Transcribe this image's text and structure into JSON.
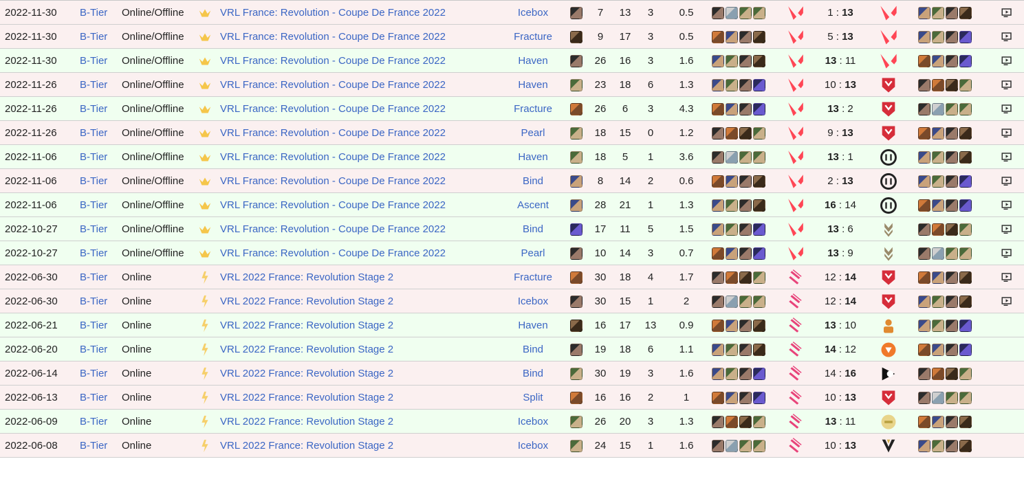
{
  "colors": {
    "win_row": "#f0fff0",
    "loss_row": "#fbf0f0",
    "link": "#3b66c4",
    "team_red": "#ff4655",
    "opp_pink": "#e8437a"
  },
  "rows": [
    {
      "date": "2022-11-30",
      "tier": "B-Tier",
      "type": "Online/Offline",
      "event": "VRL France: Revolution - Coupe De France 2022",
      "map": "Icebox",
      "k": "7",
      "d": "13",
      "a": "3",
      "kd": "0.5",
      "score_team": "1",
      "score_opp": "13",
      "result": "loss",
      "has_vod": true
    },
    {
      "date": "2022-11-30",
      "tier": "B-Tier",
      "type": "Online/Offline",
      "event": "VRL France: Revolution - Coupe De France 2022",
      "map": "Fracture",
      "k": "9",
      "d": "17",
      "a": "3",
      "kd": "0.5",
      "score_team": "5",
      "score_opp": "13",
      "result": "loss",
      "has_vod": true
    },
    {
      "date": "2022-11-30",
      "tier": "B-Tier",
      "type": "Online/Offline",
      "event": "VRL France: Revolution - Coupe De France 2022",
      "map": "Haven",
      "k": "26",
      "d": "16",
      "a": "3",
      "kd": "1.6",
      "score_team": "13",
      "score_opp": "11",
      "result": "win",
      "has_vod": true
    },
    {
      "date": "2022-11-26",
      "tier": "B-Tier",
      "type": "Online/Offline",
      "event": "VRL France: Revolution - Coupe De France 2022",
      "map": "Haven",
      "k": "23",
      "d": "18",
      "a": "6",
      "kd": "1.3",
      "score_team": "10",
      "score_opp": "13",
      "result": "loss",
      "has_vod": true
    },
    {
      "date": "2022-11-26",
      "tier": "B-Tier",
      "type": "Online/Offline",
      "event": "VRL France: Revolution - Coupe De France 2022",
      "map": "Fracture",
      "k": "26",
      "d": "6",
      "a": "3",
      "kd": "4.3",
      "score_team": "13",
      "score_opp": "2",
      "result": "win",
      "has_vod": true
    },
    {
      "date": "2022-11-26",
      "tier": "B-Tier",
      "type": "Online/Offline",
      "event": "VRL France: Revolution - Coupe De France 2022",
      "map": "Pearl",
      "k": "18",
      "d": "15",
      "a": "0",
      "kd": "1.2",
      "score_team": "9",
      "score_opp": "13",
      "result": "loss",
      "has_vod": true
    },
    {
      "date": "2022-11-06",
      "tier": "B-Tier",
      "type": "Online/Offline",
      "event": "VRL France: Revolution - Coupe De France 2022",
      "map": "Haven",
      "k": "18",
      "d": "5",
      "a": "1",
      "kd": "3.6",
      "score_team": "13",
      "score_opp": "1",
      "result": "win",
      "has_vod": true
    },
    {
      "date": "2022-11-06",
      "tier": "B-Tier",
      "type": "Online/Offline",
      "event": "VRL France: Revolution - Coupe De France 2022",
      "map": "Bind",
      "k": "8",
      "d": "14",
      "a": "2",
      "kd": "0.6",
      "score_team": "2",
      "score_opp": "13",
      "result": "loss",
      "has_vod": true
    },
    {
      "date": "2022-11-06",
      "tier": "B-Tier",
      "type": "Online/Offline",
      "event": "VRL France: Revolution - Coupe De France 2022",
      "map": "Ascent",
      "k": "28",
      "d": "21",
      "a": "1",
      "kd": "1.3",
      "score_team": "16",
      "score_opp": "14",
      "result": "win",
      "has_vod": true
    },
    {
      "date": "2022-10-27",
      "tier": "B-Tier",
      "type": "Online/Offline",
      "event": "VRL France: Revolution - Coupe De France 2022",
      "map": "Bind",
      "k": "17",
      "d": "11",
      "a": "5",
      "kd": "1.5",
      "score_team": "13",
      "score_opp": "6",
      "result": "win",
      "has_vod": true
    },
    {
      "date": "2022-10-27",
      "tier": "B-Tier",
      "type": "Online/Offline",
      "event": "VRL France: Revolution - Coupe De France 2022",
      "map": "Pearl",
      "k": "10",
      "d": "14",
      "a": "3",
      "kd": "0.7",
      "score_team": "13",
      "score_opp": "9",
      "result": "win",
      "has_vod": true
    },
    {
      "date": "2022-06-30",
      "tier": "B-Tier",
      "type": "Online",
      "event": "VRL 2022 France: Revolution Stage 2",
      "map": "Fracture",
      "k": "30",
      "d": "18",
      "a": "4",
      "kd": "1.7",
      "score_team": "12",
      "score_opp": "14",
      "result": "loss",
      "has_vod": true
    },
    {
      "date": "2022-06-30",
      "tier": "B-Tier",
      "type": "Online",
      "event": "VRL 2022 France: Revolution Stage 2",
      "map": "Icebox",
      "k": "30",
      "d": "15",
      "a": "1",
      "kd": "2",
      "score_team": "12",
      "score_opp": "14",
      "result": "loss",
      "has_vod": true
    },
    {
      "date": "2022-06-21",
      "tier": "B-Tier",
      "type": "Online",
      "event": "VRL 2022 France: Revolution Stage 2",
      "map": "Haven",
      "k": "16",
      "d": "17",
      "a": "13",
      "kd": "0.9",
      "score_team": "13",
      "score_opp": "10",
      "result": "win",
      "has_vod": false
    },
    {
      "date": "2022-06-20",
      "tier": "B-Tier",
      "type": "Online",
      "event": "VRL 2022 France: Revolution Stage 2",
      "map": "Bind",
      "k": "19",
      "d": "18",
      "a": "6",
      "kd": "1.1",
      "score_team": "14",
      "score_opp": "12",
      "result": "win",
      "has_vod": false
    },
    {
      "date": "2022-06-14",
      "tier": "B-Tier",
      "type": "Online",
      "event": "VRL 2022 France: Revolution Stage 2",
      "map": "Bind",
      "k": "30",
      "d": "19",
      "a": "3",
      "kd": "1.6",
      "score_team": "14",
      "score_opp": "16",
      "result": "loss",
      "has_vod": false
    },
    {
      "date": "2022-06-13",
      "tier": "B-Tier",
      "type": "Online",
      "event": "VRL 2022 France: Revolution Stage 2",
      "map": "Split",
      "k": "16",
      "d": "16",
      "a": "2",
      "kd": "1",
      "score_team": "10",
      "score_opp": "13",
      "result": "loss",
      "has_vod": false
    },
    {
      "date": "2022-06-09",
      "tier": "B-Tier",
      "type": "Online",
      "event": "VRL 2022 France: Revolution Stage 2",
      "map": "Icebox",
      "k": "26",
      "d": "20",
      "a": "3",
      "kd": "1.3",
      "score_team": "13",
      "score_opp": "11",
      "result": "win",
      "has_vod": false
    },
    {
      "date": "2022-06-08",
      "tier": "B-Tier",
      "type": "Online",
      "event": "VRL 2022 France: Revolution Stage 2",
      "map": "Icebox",
      "k": "24",
      "d": "15",
      "a": "1",
      "kd": "1.6",
      "score_team": "10",
      "score_opp": "13",
      "result": "loss",
      "has_vod": false
    }
  ]
}
